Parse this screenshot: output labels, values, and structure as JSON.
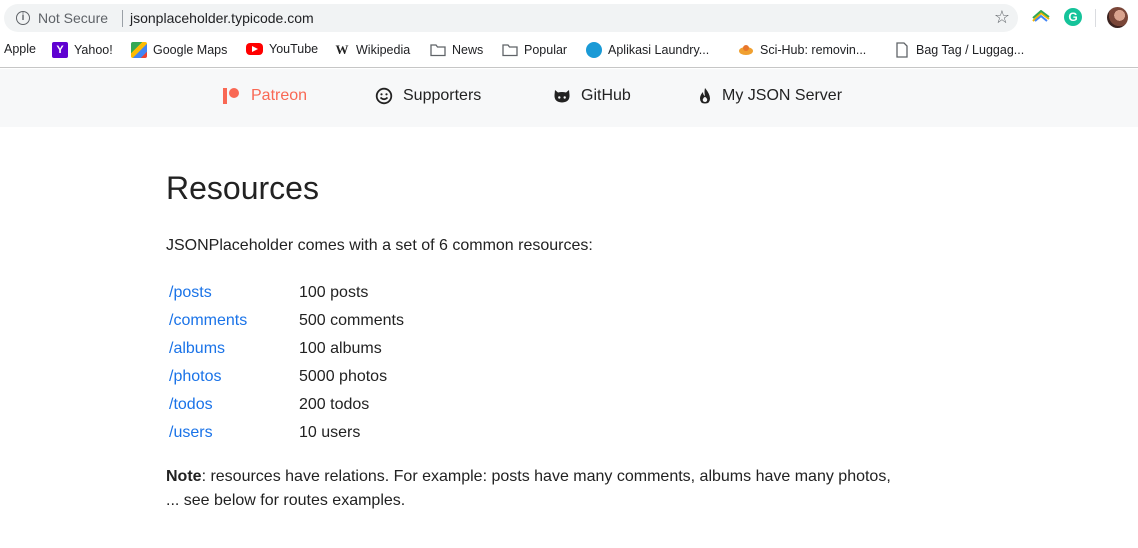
{
  "browser": {
    "security_label": "Not Secure",
    "url": "jsonplaceholder.typicode.com",
    "icons": {
      "info": "info-icon",
      "bookmark": "star-icon",
      "extension_1": "rainbow-extension-icon",
      "extension_2": "grammarly-icon",
      "profile": "avatar"
    }
  },
  "bookmarks": [
    {
      "label": "Apple",
      "icon": ""
    },
    {
      "label": "Yahoo!",
      "icon": "yahoo-icon",
      "glyph": "Y"
    },
    {
      "label": "Google Maps",
      "icon": "google-maps-icon",
      "glyph": ""
    },
    {
      "label": "YouTube",
      "icon": "youtube-icon",
      "glyph": ""
    },
    {
      "label": "Wikipedia",
      "icon": "wikipedia-icon",
      "glyph": "W"
    },
    {
      "label": "News",
      "icon": "folder-icon",
      "glyph": ""
    },
    {
      "label": "Popular",
      "icon": "folder-icon",
      "glyph": ""
    },
    {
      "label": "Aplikasi Laundry...",
      "icon": "laundry-app-icon",
      "glyph": ""
    },
    {
      "label": "Sci-Hub: removin...",
      "icon": "scihub-icon",
      "glyph": ""
    },
    {
      "label": "Bag Tag / Luggag...",
      "icon": "document-icon",
      "glyph": ""
    }
  ],
  "site_nav": {
    "patreon": "Patreon",
    "supporters": "Supporters",
    "github": "GitHub",
    "my_json_server": "My JSON Server"
  },
  "colors": {
    "patreon": "#f96854",
    "link": "#1a73e8",
    "nav_bg": "#f7f8f9"
  },
  "content": {
    "title": "Resources",
    "intro": "JSONPlaceholder comes with a set of 6 common resources:",
    "resources": [
      {
        "path": "/posts",
        "count": "100 posts"
      },
      {
        "path": "/comments",
        "count": "500 comments"
      },
      {
        "path": "/albums",
        "count": "100 albums"
      },
      {
        "path": "/photos",
        "count": "5000 photos"
      },
      {
        "path": "/todos",
        "count": "200 todos"
      },
      {
        "path": "/users",
        "count": "10 users"
      }
    ],
    "note_label": "Note",
    "note_text": ": resources have relations. For example: posts have many comments, albums have many photos,",
    "note_text_2": "... see below for routes examples."
  }
}
